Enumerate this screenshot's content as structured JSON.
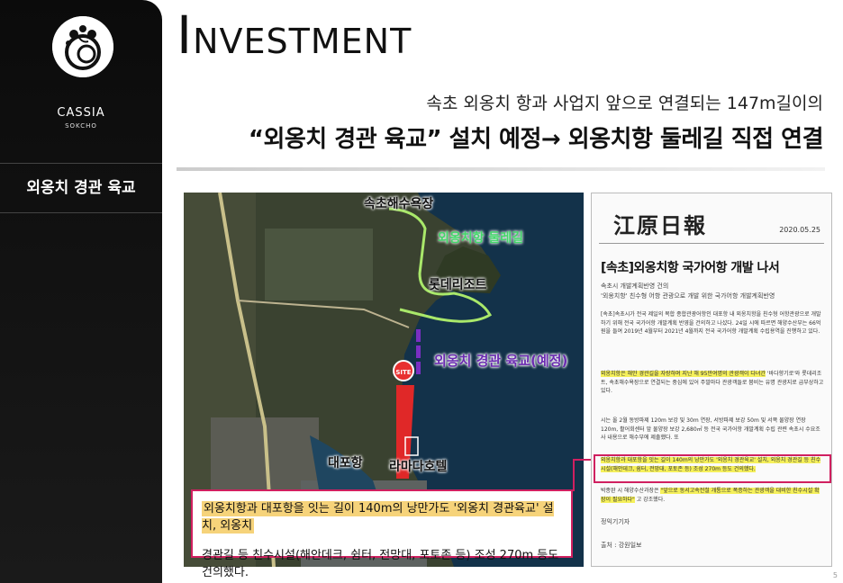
{
  "brand": {
    "name": "CASSIA",
    "sub": "SOKCHO"
  },
  "sidebar": {
    "menu_item": "외옹치 경관 육교"
  },
  "header": {
    "title_first": "I",
    "title_rest": "NVESTMENT",
    "subtitle1": "속초 외옹치 항과 사업지 앞으로 연결되는 147m길이의",
    "subtitle2": "“외옹치 경관 육교” 설치 예정→ 외옹치항 둘레길 직접 연결"
  },
  "map": {
    "labels": {
      "beach": "속초해수욕장",
      "trail": "외옹치항 둘레길",
      "resort": "롯데리조트",
      "bridge": "외옹치 경관 육교(예정)",
      "daepo": "대포항",
      "ramada": "라마다호텔",
      "site": "SITE"
    },
    "callout_line1": "외옹치항과 대포항을 잇는 길이 140m의 낭만가도 '외옹치 경관육교' 설치, 외옹치",
    "callout_line2": "경관길 등 친수시설(해안데크, 쉼터, 전망대, 포토존 등) 조성 270m 등도 건의했다."
  },
  "newspaper": {
    "masthead": "江原日報",
    "date": "2020.05.25",
    "headline": "[속초]외옹치항 국가어항 개발 나서",
    "sub1": "속초시 개발계획반영 건의",
    "sub2": "'외옹치항' 친수형 어항 관광으로 개발 위한 국가어항 개발계획반영",
    "para1": "[속초]속초시가 전국 제일의 복합 종합관광어항인 대포항 내 외옹치항을 친수형 어항관광으로 개발하기 위해 전국 국가어항 개발계획 반영을 건의하고 나섰다. 24일 시에 따르면 해양수산부는 66억원을 들여 2019년 4월부터 2021년 4월까지 전국 국가어항 개발계획 수립용역을 진행하고 있다.",
    "para2_hl": "외옹치항은 해안 경관길을 자랑하며 지난 해 95만여명의 관광객이 다녀간",
    "para2": "'바다향기로'와 롯데리조트, 속초해수욕장으로 연결되는 중심에 있어 주말마다 관광객들로 붐비는 유명 관광지로 급부상하고 있다.",
    "para3": "시는 올 2월 동방파제 120m 보강 및 30m 연장, 서방파제 보강 50m 및 서쪽 물양장 연장 120m, 활어회센터 앞 물양장 보강 2,680㎡ 등 전국 국가어항 개발계획 수립 관련 속초시 수요조사 내용으로 해수부에 제출했다. 또",
    "para4_hl": "외옹치항과 대포항을 잇는 길이 140m의 낭만가도 '외옹치 경관육교' 설치, 외옹치 경관길 등 친수시설(해안데크, 쉼터, 전망대, 포토존 등) 조성 270m 등도 건의했다.",
    "para5": "박종완 시 해양수산과장은",
    "para5_hl": "\"앞으로 동서고속전철 개통으로 폭증하는 관광객을 대비한 친수시설 확장이 필요하다\"",
    "para5_end": "고 강조했다.",
    "reporter": "정익기기자",
    "source": "출처 : 강원일보"
  },
  "page": {
    "number": "5"
  }
}
